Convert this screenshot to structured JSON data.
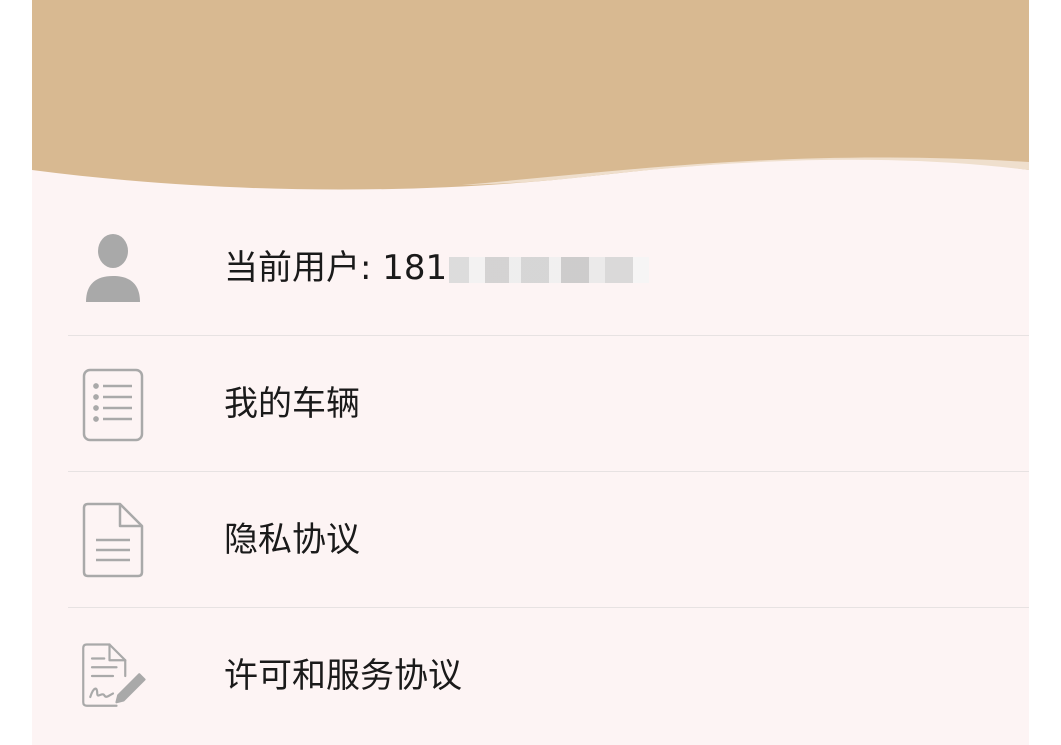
{
  "colors": {
    "header": "#d8b991",
    "header_highlight": "#efdfcd",
    "background": "#fdf4f4",
    "icon": "#a9a9a9",
    "text": "#1a1a1a",
    "divider": "#e7e2e2"
  },
  "menu": {
    "items": [
      {
        "icon": "user-icon",
        "label": "当前用户: 181",
        "masked": true
      },
      {
        "icon": "list-document-icon",
        "label": "我的车辆"
      },
      {
        "icon": "document-icon",
        "label": "隐私协议"
      },
      {
        "icon": "signed-document-icon",
        "label": "许可和服务协议"
      }
    ]
  }
}
